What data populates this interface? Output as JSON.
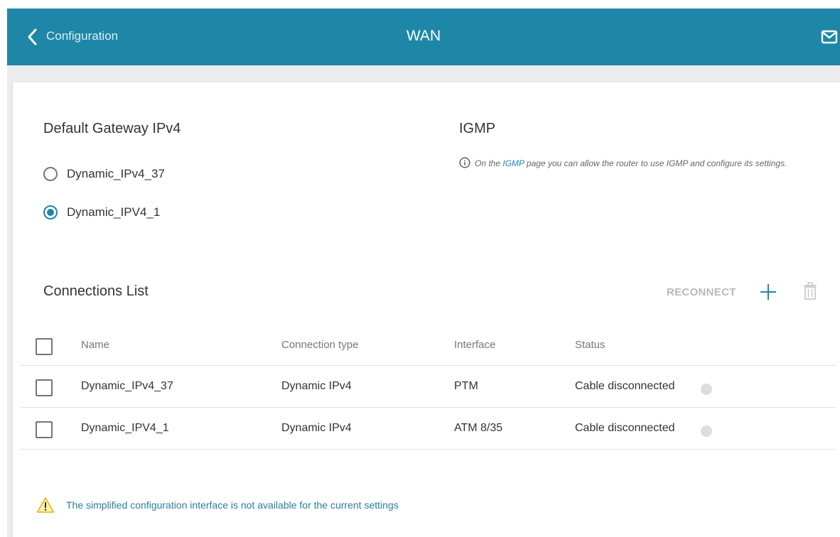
{
  "header": {
    "back_label": "Configuration",
    "title": "WAN",
    "bg_color": "#1e87a8"
  },
  "default_gateway": {
    "title": "Default Gateway IPv4",
    "options": [
      {
        "label": "Dynamic_IPv4_37",
        "selected": false
      },
      {
        "label": "Dynamic_IPV4_1",
        "selected": true
      }
    ]
  },
  "igmp": {
    "title": "IGMP",
    "note_prefix": "On the",
    "note_link": "IGMP",
    "note_suffix": "page you can allow the router to use IGMP and configure its settings."
  },
  "connections": {
    "title": "Connections List",
    "reconnect_label": "RECONNECT",
    "columns": [
      "Name",
      "Connection type",
      "Interface",
      "Status"
    ],
    "rows": [
      {
        "name": "Dynamic_IPv4_37",
        "type": "Dynamic IPv4",
        "interface": "PTM",
        "status": "Cable disconnected"
      },
      {
        "name": "Dynamic_IPV4_1",
        "type": "Dynamic IPv4",
        "interface": "ATM 8/35",
        "status": "Cable disconnected"
      }
    ]
  },
  "warning": {
    "text": "The simplified configuration interface is not available for the current settings"
  }
}
